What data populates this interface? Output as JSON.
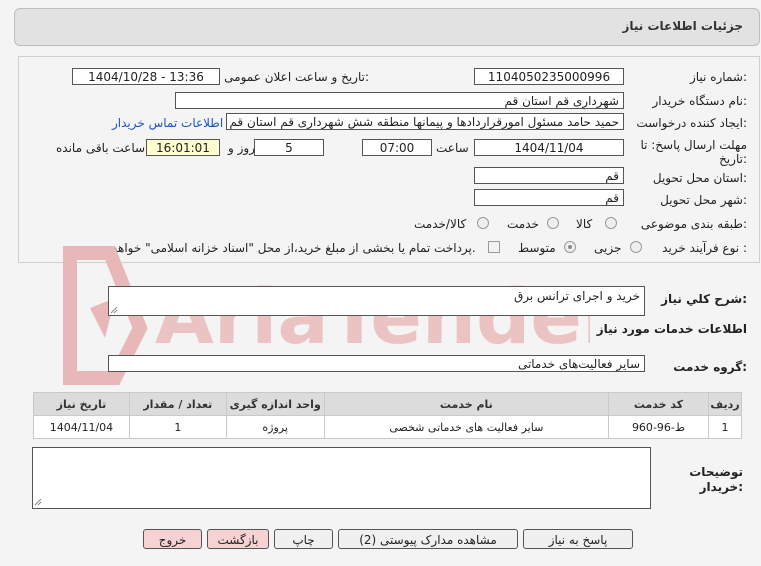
{
  "header": {
    "title": "جزئیات اطلاعات نیاز"
  },
  "fields": {
    "need_number_label": "شماره نیاز:",
    "need_number": "1104050235000996",
    "announce_label": "تاریخ و ساعت اعلان عمومی:",
    "announce_value": "1404/10/28 - 13:36",
    "buyer_label": "نام دستگاه خریدار:",
    "buyer_value": "شهرداری قم استان قم",
    "creator_label": "ایجاد کننده درخواست:",
    "creator_value": "حمید حامد مسئول امورقراردادها و پیمانها منطقه شش شهرداری قم استان قم",
    "contact_link": "اطلاعات تماس خریدار",
    "deadline_label_1": "مهلت ارسال پاسخ: تا",
    "deadline_label_2": "تاریخ:",
    "deadline_date": "1404/11/04",
    "time_label": "ساعت",
    "deadline_time": "07:00",
    "days_value": "5",
    "days_label": "روز و",
    "remaining_time": "16:01:01",
    "remaining_label": "ساعت باقی مانده",
    "province_label": "استان محل تحویل:",
    "province_value": "قم",
    "city_label": "شهر محل تحویل:",
    "city_value": "قم",
    "category_label": "طبقه بندی موضوعی:",
    "category_options": [
      "کالا",
      "خدمت",
      "کالا/خدمت"
    ],
    "category_selected": "خدمت",
    "process_label": "نوع فرآیند خرید :",
    "process_options": [
      "جزیی",
      "متوسط"
    ],
    "process_selected": "متوسط",
    "payment_note": "پرداخت تمام یا بخشی از مبلغ خرید،از محل \"اسناد خزانه اسلامی\" خواهد بود."
  },
  "description": {
    "label": "شرح کلي نياز:",
    "value": "خرید و اجرای ترانس برق"
  },
  "services": {
    "section_title": "اطلاعات خدمات مورد نیاز",
    "group_label": "گروه خدمت:",
    "group_value": "سایر فعالیت‌های خدماتی",
    "columns": [
      "ردیف",
      "کد خدمت",
      "نام خدمت",
      "واحد اندازه گیری",
      "تعداد / مقدار",
      "تاریخ نیاز"
    ],
    "rows": [
      {
        "row": "1",
        "code": "ط-96-960",
        "name": "سایر فعالیت های خدماتی شخصی",
        "unit": "پروژه",
        "qty": "1",
        "date": "1404/11/04"
      }
    ]
  },
  "buyer_notes": {
    "label_1": "توضیحات",
    "label_2": "خریدار:",
    "value": ""
  },
  "buttons": {
    "reply": "پاسخ به نیاز",
    "attachments": "مشاهده مدارک پیوستی (2)",
    "print": "چاپ",
    "back": "بازگشت",
    "exit": "خروج"
  },
  "watermark": {
    "text": "AriaTender.net"
  },
  "colors": {
    "header_bg": "#e2e2e2",
    "time_bg": "#fdfdcf",
    "link": "#1a55c0",
    "danger_btn": "#f7d2d2",
    "watermark": "#e8b8b8"
  }
}
